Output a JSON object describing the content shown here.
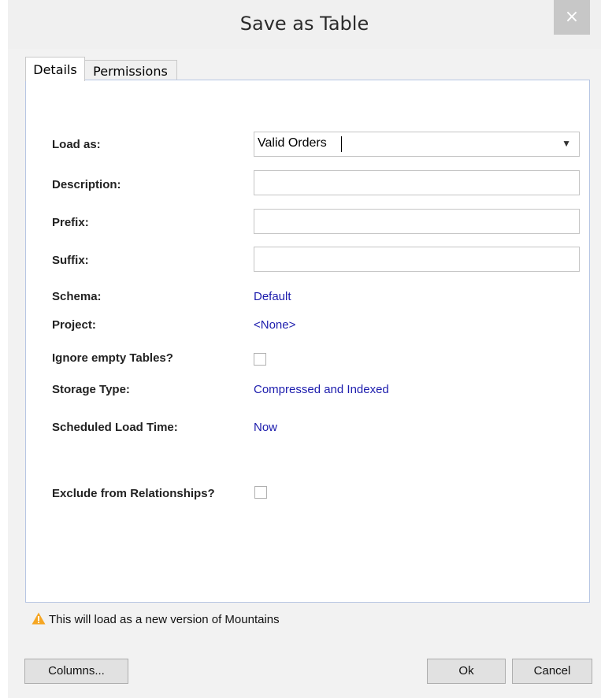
{
  "window": {
    "title": "Save as Table",
    "close_glyph": "×"
  },
  "tabs": [
    {
      "label": "Details",
      "active": true
    },
    {
      "label": "Permissions",
      "active": false
    }
  ],
  "form": {
    "load_as": {
      "label": "Load as:",
      "value": "Valid Orders"
    },
    "description": {
      "label": "Description:",
      "value": ""
    },
    "prefix": {
      "label": "Prefix:",
      "value": ""
    },
    "suffix": {
      "label": "Suffix:",
      "value": ""
    },
    "schema": {
      "label": "Schema:",
      "value": "Default"
    },
    "project": {
      "label": "Project:",
      "value": "<None>"
    },
    "ignore_empty": {
      "label": "Ignore empty Tables?",
      "checked": false
    },
    "storage_type": {
      "label": "Storage Type:",
      "value": "Compressed and Indexed"
    },
    "scheduled_load_time": {
      "label": "Scheduled Load Time:",
      "value": "Now"
    },
    "exclude_relationships": {
      "label": "Exclude from Relationships?",
      "checked": false
    }
  },
  "warning": {
    "icon": "warning-triangle-icon",
    "text": "This will load as a new version of  Mountains"
  },
  "buttons": {
    "columns": "Columns...",
    "ok": "Ok",
    "cancel": "Cancel"
  },
  "colors": {
    "link_value": "#1c1cad",
    "panel_border": "#b7c6e3",
    "dialog_bg": "#f2f2f2",
    "warning": "#f5a623"
  }
}
